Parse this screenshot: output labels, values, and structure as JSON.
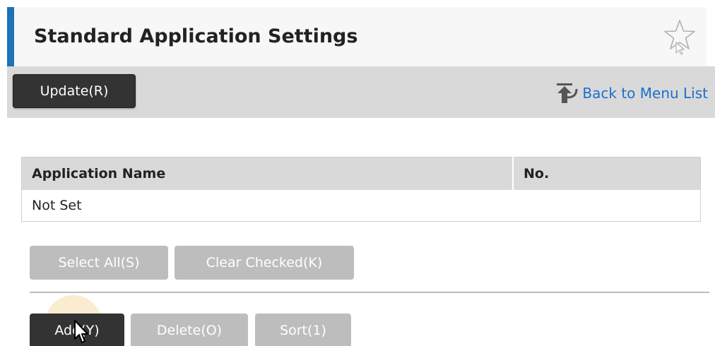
{
  "header": {
    "title": "Standard Application Settings",
    "favorite_icon": "star-outline-icon",
    "accent_color": "#1d72b8"
  },
  "toolbar": {
    "update_label": "Update(R)",
    "back_label": "Back to Menu List",
    "back_icon": "back-arrow-icon",
    "link_color": "#1e6fcc"
  },
  "table": {
    "columns": [
      "Application Name",
      "No."
    ],
    "rows": [
      [
        "Not Set",
        ""
      ]
    ]
  },
  "selection_buttons": {
    "select_all_label": "Select All(S)",
    "clear_checked_label": "Clear Checked(K)"
  },
  "action_buttons": {
    "add_label": "Add(Y)",
    "delete_label": "Delete(O)",
    "sort_label": "Sort(1)"
  }
}
